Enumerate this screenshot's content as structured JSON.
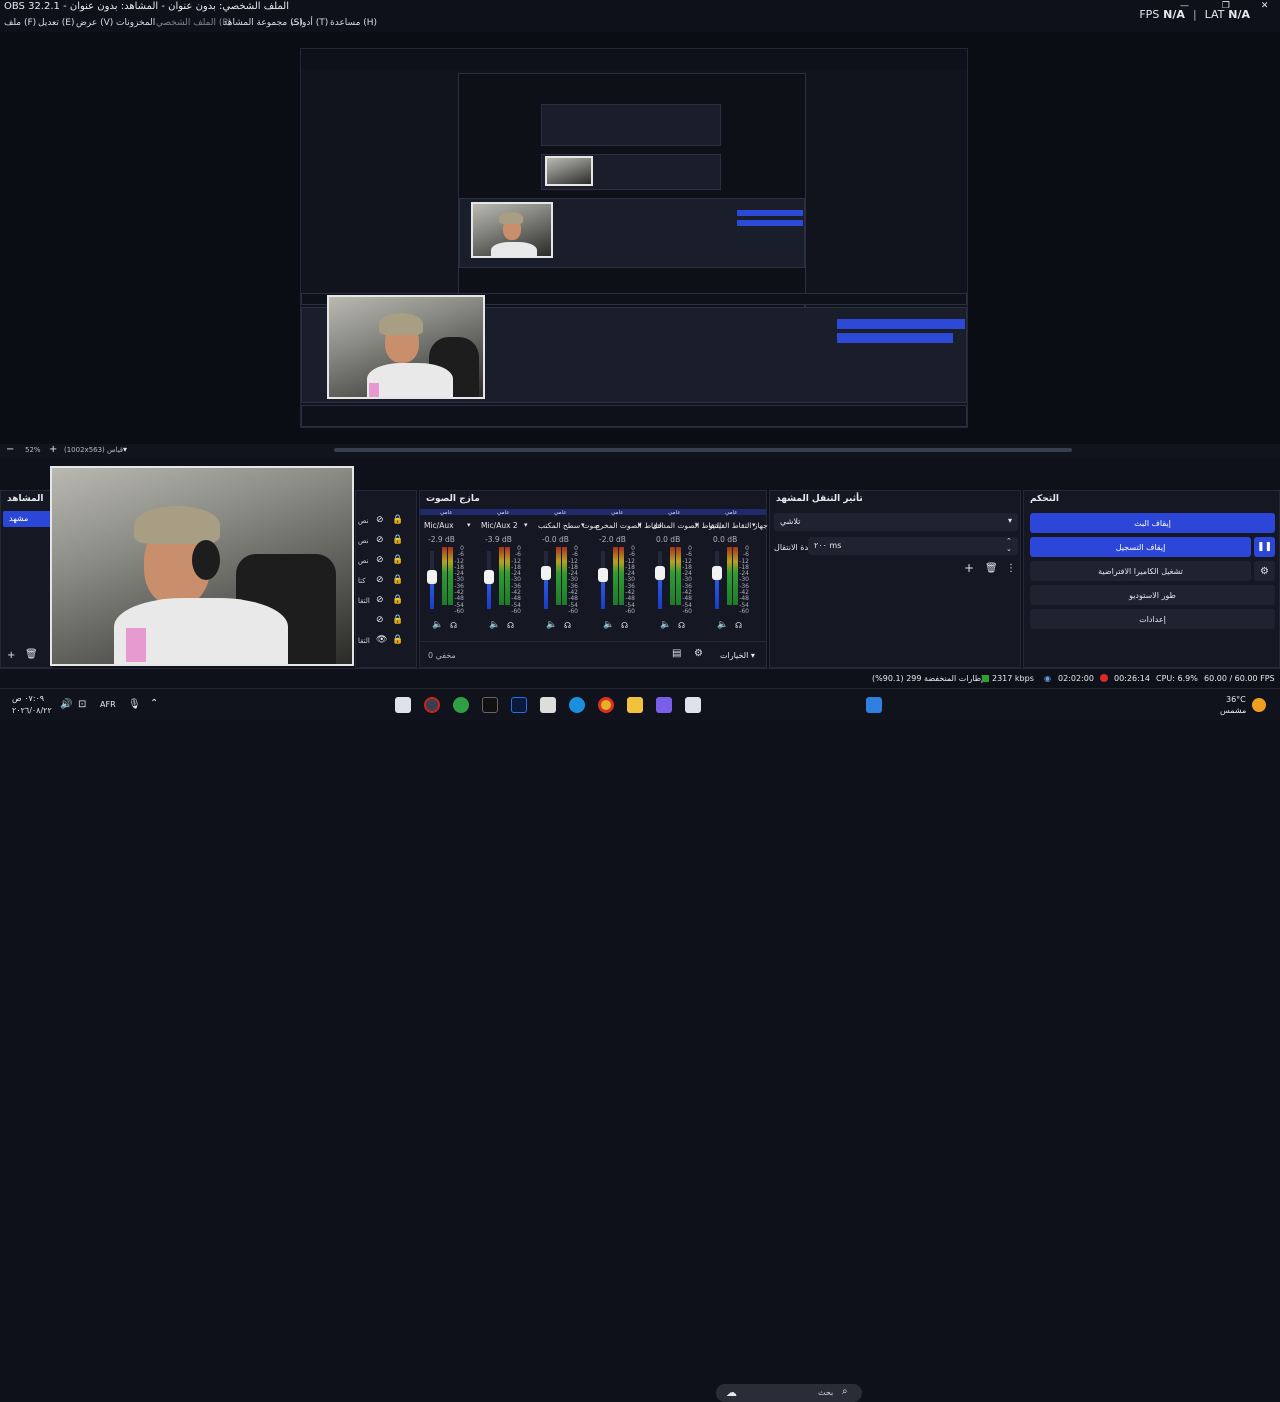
{
  "window": {
    "title": "OBS 32.2.1 - الملف الشخصي: بدون عنوان - المشاهد: بدون عنوان",
    "fps_label": "FPS",
    "fps_value": "N/A",
    "lat_label": "LAT",
    "lat_value": "N/A"
  },
  "menu": [
    {
      "label": "ملف (F)"
    },
    {
      "label": "تعديل (E)"
    },
    {
      "label": "عرض (V)"
    },
    {
      "label": "المخزونات"
    },
    {
      "label": "الملف الشخصي (P)"
    },
    {
      "label": "مجموعة المشاهد (S)"
    },
    {
      "label": "أدوات (T)"
    },
    {
      "label": "مساعدة (H)"
    }
  ],
  "zoom": {
    "percent": "52%",
    "size_text": "(1002x563) قياس"
  },
  "scenes": {
    "title": "المشاهد",
    "items": [
      {
        "label": "مشهد",
        "selected": true
      }
    ]
  },
  "sources": {
    "items": [
      "نص",
      "نص",
      "نص",
      "كتا",
      "التقا",
      "",
      "التقا"
    ]
  },
  "mixer": {
    "title": "مازج الصوت",
    "mute_tag": "عامي",
    "channels": [
      {
        "name": "Mic/Aux",
        "db": "-2.9 dB",
        "level": 0.55,
        "accent": "#e35252"
      },
      {
        "name": "Mic/Aux 2",
        "db": "-3.9 dB",
        "level": 0.55,
        "accent": "#e35252"
      },
      {
        "name": "صوت سطح المكتب",
        "db": "-0.0 dB",
        "level": 0.62,
        "accent": "#e35252"
      },
      {
        "name": "التقاط الصوت المخرج",
        "db": "-2.0 dB",
        "level": 0.58,
        "accent": "#e35252"
      },
      {
        "name": "التقاط الصوت المدخل",
        "db": "0.0 dB",
        "level": 0.62,
        "accent": "#e35252"
      },
      {
        "name": "جهاز التقاط الفيديو",
        "db": "0.0 dB",
        "level": 0.62,
        "accent": "#e35252"
      }
    ],
    "scale": [
      "0",
      "-6",
      "-12",
      "-18",
      "-24",
      "-30",
      "-36",
      "-42",
      "-48",
      "-54",
      "-60"
    ],
    "footer_label": "مخفي 0",
    "options_label": "الخيارات"
  },
  "transitions": {
    "title": "تأثير التنقل المشهد",
    "selected": "تلاشي",
    "duration_label": "مدة الانتقال",
    "duration_value": "٢٠٠ ms"
  },
  "controls": {
    "title": "التحكم",
    "stop_stream": "إيقاف البث",
    "stop_recording": "إيقاف التسجيل",
    "virtual_camera": "تشغيل الكاميرا الافتراضية",
    "studio_mode": "طور الاستوديو",
    "settings": "إعدادات"
  },
  "status": {
    "dropped_frames": "الإطارات المنخفضة 299 (90.1%)",
    "bitrate": "2317 kbps",
    "stream_time": "02:02:00",
    "rec_time": "00:26:14",
    "cpu": "CPU: 6.9%",
    "fps": "60.00 / 60.00 FPS"
  },
  "taskbar": {
    "time": "٠٧:٠٩ ص",
    "date": "٢٠٢٦/٠٨/٢٢",
    "lang": "AFR",
    "search_placeholder": "بحث",
    "temp": "36°C",
    "weather": "مشمس"
  },
  "colors": {
    "accent_blue": "#2c47d8",
    "panel_bg": "#151822",
    "app_bg": "#0f111a",
    "rec_red": "#e02626"
  }
}
